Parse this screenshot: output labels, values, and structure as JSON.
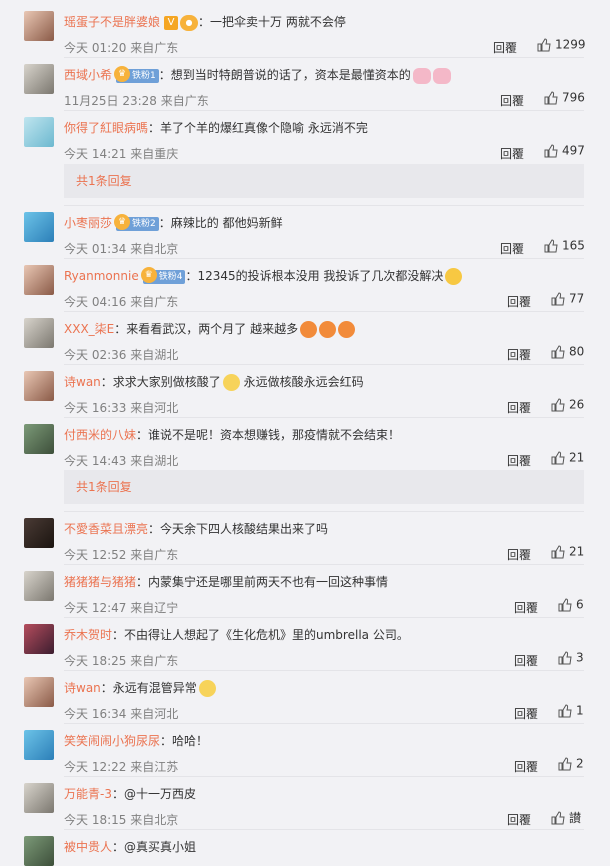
{
  "ui": {
    "reply_label": "回覆",
    "accent_color": "#eb7350"
  },
  "comments": [
    {
      "name": "瑶蛋子不是胖婆娘",
      "text": "：一把伞卖十万 两就不会停",
      "time": "今天 01:20",
      "source": "来自广东",
      "likes": "1299"
    },
    {
      "name": "西域小希",
      "badge": "铁粉1",
      "text": "：想到当时特朗普说的话了，资本是最懂资本的",
      "time": "11月25日 23:28",
      "source": "来自广东",
      "likes": "796"
    },
    {
      "name": "你得了紅眼病嗎",
      "text": "：羊了个羊的爆红真像个隐喻 永远消不完",
      "time": "今天 14:21",
      "source": "来自重庆",
      "likes": "497"
    },
    {
      "name": "小枣丽莎",
      "badge": "铁粉2",
      "text": "：麻辣比的 都他妈新鲜",
      "time": "今天 01:34",
      "source": "来自北京",
      "likes": "165"
    },
    {
      "name": "Ryanmonnie",
      "badge": "铁粉4",
      "text": "：12345的投诉根本没用 我投诉了几次都没解决",
      "time": "今天 04:16",
      "source": "来自广东",
      "likes": "77"
    },
    {
      "name": "XXX_柒E",
      "text": "：来看看武汉，两个月了 越来越多",
      "time": "今天 02:36",
      "source": "来自湖北",
      "likes": "80"
    },
    {
      "name": "诗wan",
      "text": "：求求大家别做核酸了",
      "text2": " 永远做核酸永远会红码",
      "time": "今天 16:33",
      "source": "来自河北",
      "likes": "26"
    },
    {
      "name": "付西米的八妹",
      "text": "：谁说不是呢！资本想赚钱，那疫情就不会结束！",
      "time": "今天 14:43",
      "source": "来自湖北",
      "likes": "21"
    },
    {
      "name": "不愛香菜且漂亮",
      "text": "：今天余下四人核酸结果出来了吗",
      "time": "今天 12:52",
      "source": "来自广东",
      "likes": "21"
    },
    {
      "name": "猪猪猪与猪猪",
      "text": "：内蒙集宁还是哪里前两天不也有一回这种事情",
      "time": "今天 12:47",
      "source": "来自辽宁",
      "likes": "6"
    },
    {
      "name": "乔木贺时",
      "text": "：不由得让人想起了《生化危机》里的umbrella 公司。",
      "time": "今天 18:25",
      "source": "来自广东",
      "likes": "3"
    },
    {
      "name": "诗wan",
      "text": "：永远有混管异常",
      "time": "今天 16:34",
      "source": "来自河北",
      "likes": "1"
    },
    {
      "name": "笑笑闹闹小狗尿尿",
      "text": "：哈哈！",
      "time": "今天 12:22",
      "source": "来自江苏",
      "likes": "2"
    },
    {
      "name": "万能青-3",
      "text": "：@十一万西皮",
      "time": "今天 18:15",
      "source": "来自北京",
      "likes": "讃"
    },
    {
      "name": "被中贵人",
      "text": "：@真买真小姐",
      "time": "",
      "source": "",
      "likes": ""
    }
  ],
  "sub_replies": [
    {
      "label": "共1条回复"
    },
    {
      "label": "共1条回复"
    }
  ]
}
